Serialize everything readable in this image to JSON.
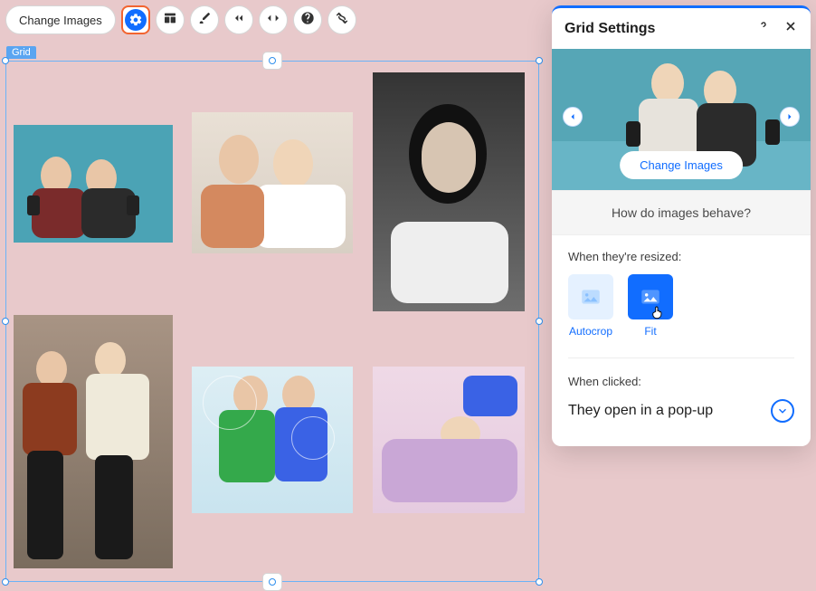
{
  "toolbar": {
    "change_images_label": "Change Images"
  },
  "selection": {
    "label": "Grid"
  },
  "panel": {
    "title": "Grid Settings",
    "hero": {
      "change_images_label": "Change Images"
    },
    "behave_question": "How do images behave?",
    "resize": {
      "label": "When they're resized:",
      "options": {
        "autocrop": "Autocrop",
        "fit": "Fit"
      },
      "selected": "fit"
    },
    "clicked": {
      "label": "When clicked:",
      "value": "They open in a pop-up"
    }
  }
}
